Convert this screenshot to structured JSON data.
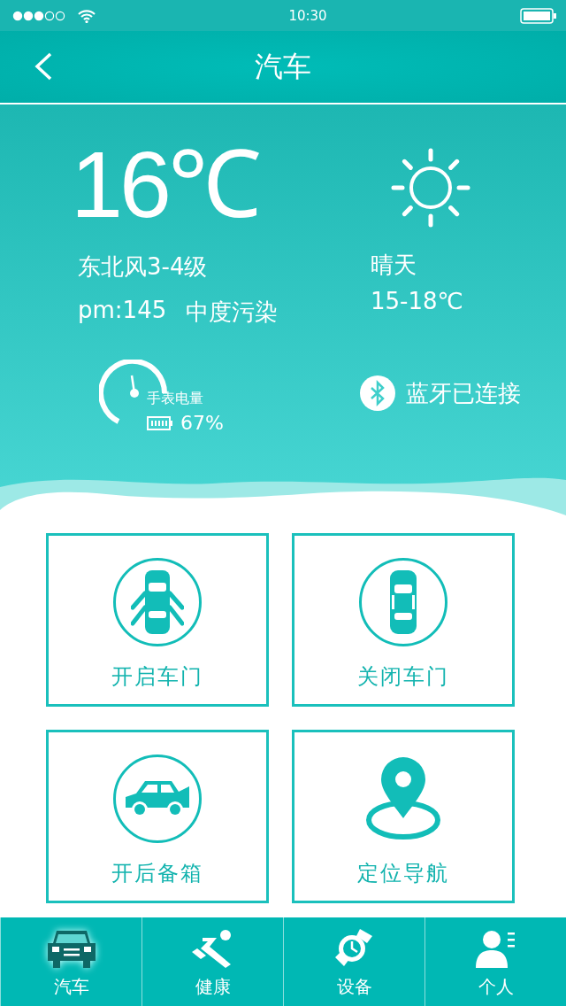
{
  "status_bar": {
    "time": "10:30"
  },
  "nav": {
    "title": "汽车"
  },
  "weather": {
    "temperature": "16℃",
    "wind": "东北风3-4级",
    "pm": "pm:145",
    "pollution": "中度污染",
    "condition": "晴天",
    "range": "15-18℃"
  },
  "watch": {
    "label": "手表电量",
    "battery": "67%"
  },
  "bluetooth": {
    "label": "蓝牙已连接"
  },
  "actions": [
    {
      "kind": "door-open",
      "label": "开启车门"
    },
    {
      "kind": "door-close",
      "label": "关闭车门"
    },
    {
      "kind": "trunk",
      "label": "开后备箱"
    },
    {
      "kind": "location",
      "label": "定位导航"
    }
  ],
  "tabs": [
    {
      "kind": "car",
      "label": "汽车",
      "selected": true
    },
    {
      "kind": "run",
      "label": "健康",
      "selected": false
    },
    {
      "kind": "watch",
      "label": "设备",
      "selected": false
    },
    {
      "kind": "person",
      "label": "个人",
      "selected": false
    }
  ]
}
